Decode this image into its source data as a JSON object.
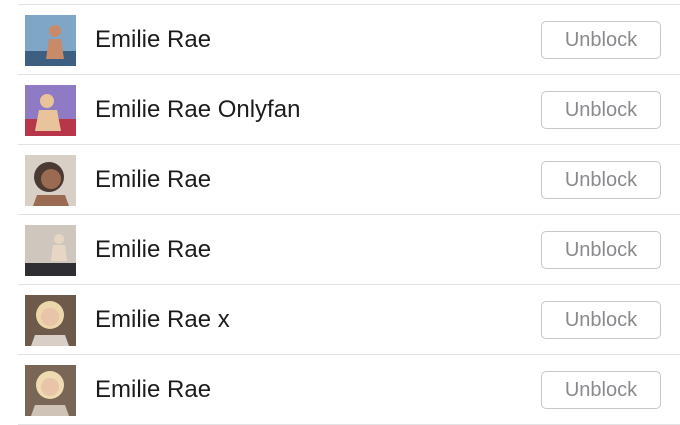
{
  "blocked_users": [
    {
      "name": "Emilie Rae",
      "action_label": "Unblock",
      "avatar_icon": "profile-photo-icon",
      "colors": {
        "bg": "#7fa6c7",
        "accent": "#c98a6a",
        "ground": "#3c5f82"
      }
    },
    {
      "name": "Emilie Rae Onlyfan",
      "action_label": "Unblock",
      "avatar_icon": "profile-photo-icon",
      "colors": {
        "bg": "#8f7ac4",
        "accent": "#e9c39a",
        "ground": "#b7364a"
      }
    },
    {
      "name": "Emilie Rae",
      "action_label": "Unblock",
      "avatar_icon": "profile-photo-icon",
      "colors": {
        "bg": "#d8cfc7",
        "accent": "#9a6b52",
        "ground": "#4a3a33"
      }
    },
    {
      "name": "Emilie Rae",
      "action_label": "Unblock",
      "avatar_icon": "profile-photo-icon",
      "colors": {
        "bg": "#cfc7bd",
        "accent": "#e8d6c4",
        "ground": "#2f2f33"
      }
    },
    {
      "name": "Emilie Rae x",
      "action_label": "Unblock",
      "avatar_icon": "profile-photo-icon",
      "colors": {
        "bg": "#6e5a4a",
        "accent": "#ecd7ad",
        "ground": "#d9cfc6"
      }
    },
    {
      "name": "Emilie Rae",
      "action_label": "Unblock",
      "avatar_icon": "profile-photo-icon",
      "colors": {
        "bg": "#7a6656",
        "accent": "#eedbb2",
        "ground": "#cfc3b8"
      }
    }
  ]
}
